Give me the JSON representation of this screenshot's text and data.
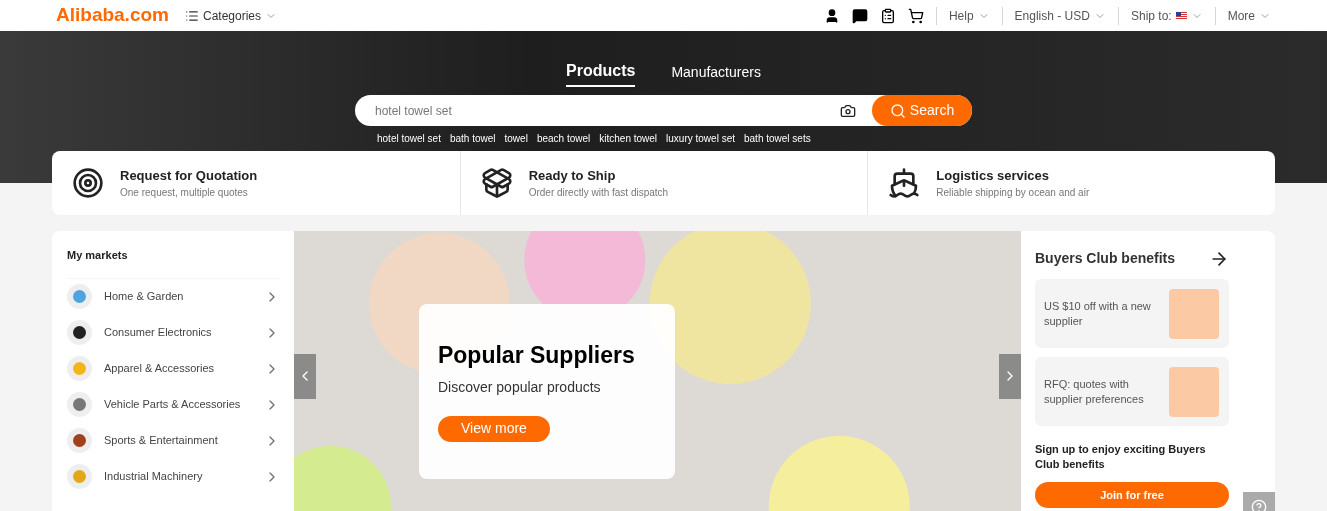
{
  "header": {
    "logo": "Alibaba.com",
    "categories": "Categories",
    "links": [
      {
        "label": "Help"
      },
      {
        "label": "English - USD"
      },
      {
        "label": "Ship to:",
        "flag": true
      },
      {
        "label": "More"
      }
    ]
  },
  "search_tabs": [
    {
      "label": "Products",
      "selected": true
    },
    {
      "label": "Manufacturers",
      "selected": false
    }
  ],
  "search": {
    "placeholder": "hotel towel set",
    "button": "Search"
  },
  "suggestions": [
    "hotel towel set",
    "bath towel",
    "towel",
    "beach towel",
    "kitchen towel",
    "luxury towel set",
    "bath towel sets"
  ],
  "services": [
    {
      "kind": "target",
      "title": "Request for Quotation",
      "subtitle": "One request, multiple quotes"
    },
    {
      "kind": "box",
      "title": "Ready to Ship",
      "subtitle": "Order directly with fast dispatch"
    },
    {
      "kind": "ship",
      "title": "Logistics services",
      "subtitle": "Reliable shipping by ocean and air"
    }
  ],
  "markets": {
    "title": "My markets",
    "items": [
      {
        "label": "Home & Garden",
        "color": "#4fa3e0"
      },
      {
        "label": "Consumer Electronics",
        "color": "#222222"
      },
      {
        "label": "Apparel & Accessories",
        "color": "#f2b51c"
      },
      {
        "label": "Vehicle Parts & Accessories",
        "color": "#777777"
      },
      {
        "label": "Sports & Entertainment",
        "color": "#a0401f"
      },
      {
        "label": "Industrial Machinery",
        "color": "#e0a81a"
      }
    ]
  },
  "banner": {
    "title": "Popular Suppliers",
    "subtitle": "Discover popular products",
    "button": "View more"
  },
  "buyers_club": {
    "title": "Buyers Club benefits",
    "benefits": [
      "US $10 off with a new supplier",
      "RFQ: quotes with supplier preferences"
    ],
    "signup": "Sign up to enjoy exciting Buyers Club benefits",
    "button": "Join for free"
  }
}
